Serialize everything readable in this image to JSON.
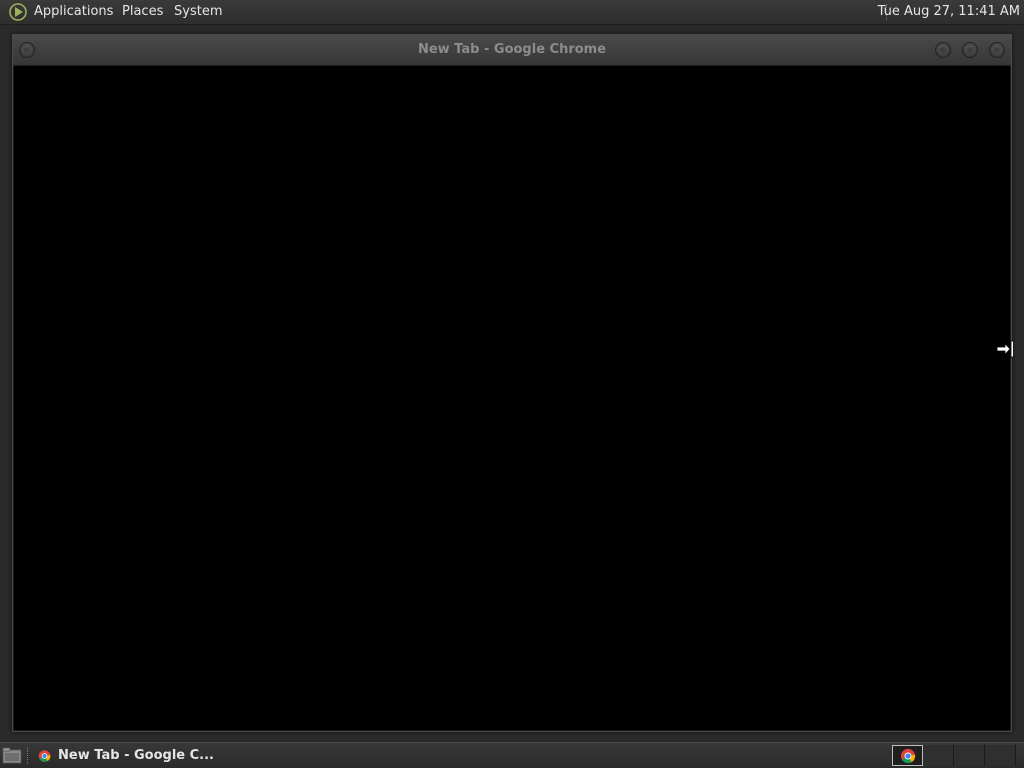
{
  "top_panel": {
    "menus": [
      {
        "label": "Applications"
      },
      {
        "label": "Places"
      },
      {
        "label": "System"
      }
    ],
    "clock": "Tue Aug 27, 11:41 AM"
  },
  "window": {
    "title": "New Tab - Google Chrome"
  },
  "taskbar": {
    "task_label": "New Tab - Google C...",
    "workspaces": 4,
    "active_workspace": 1
  },
  "colors": {
    "panel": "#2e2e2e",
    "window_content": "#000000",
    "title_text": "#8c8c8c",
    "chrome_red": "#db4437",
    "chrome_green": "#0f9d58",
    "chrome_yellow": "#f4b400",
    "chrome_blue": "#4285f4"
  },
  "icons": {
    "menu_logo": "menu-logo-icon",
    "show_desktop": "show-desktop-icon",
    "task": "chrome-icon",
    "cursor": "resize-right-cursor-icon"
  }
}
